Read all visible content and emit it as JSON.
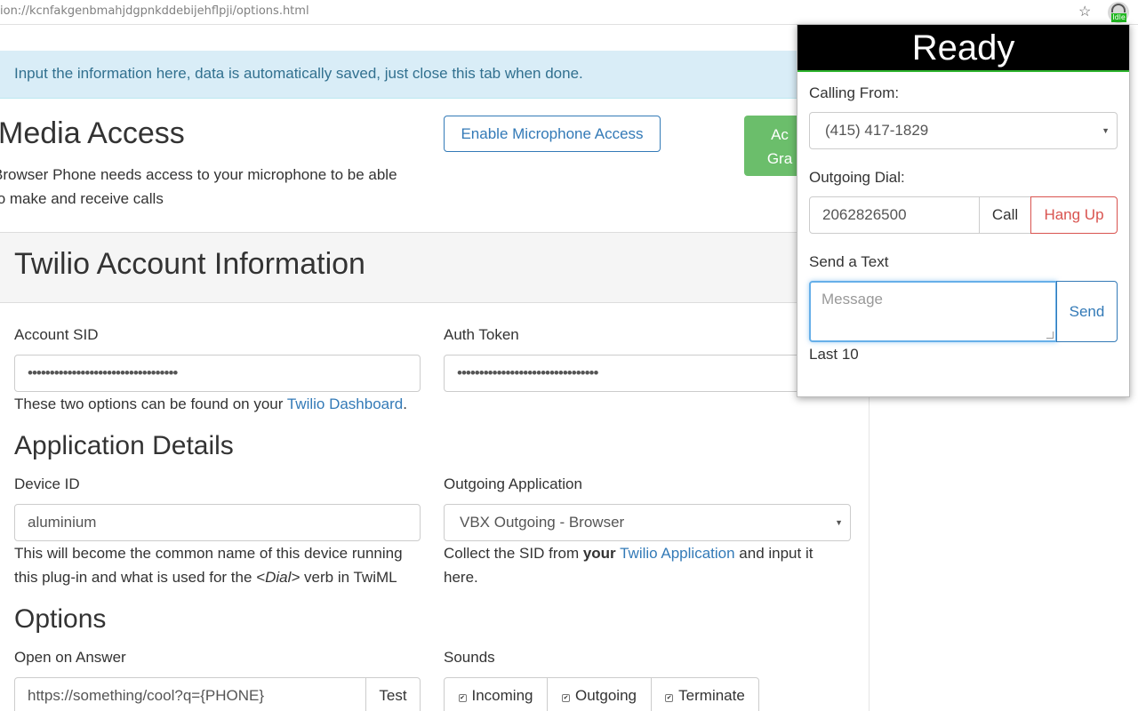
{
  "browser": {
    "url": "ion://kcnfakgenbmahjdgpnkddebijehflpji/options.html",
    "extension_badge": "Idle"
  },
  "alert": "Input the information here, data is automatically saved, just close this tab when done.",
  "media": {
    "title": "Media Access",
    "desc_line1": "Browser Phone needs access to your microphone to be able",
    "desc_line2": "to make and receive calls",
    "enable_button": "Enable Microphone Access",
    "green_button_line1": "Ac",
    "green_button_line2": "Gra"
  },
  "twilio": {
    "title": "Twilio Account Information",
    "sid_label": "Account SID",
    "sid_value": "••••••••••••••••••••••••••••••••••",
    "token_label": "Auth Token",
    "token_value": "••••••••••••••••••••••••••••••••",
    "help_prefix": "These two options can be found on your ",
    "help_link": "Twilio Dashboard",
    "help_suffix": "."
  },
  "app": {
    "title": "Application Details",
    "device_label": "Device ID",
    "device_value": "aluminium",
    "device_help_1": "This will become the common name of this device running",
    "device_help_2a": "this plug-in and what is used for the ",
    "device_help_2b": "<Dial>",
    "device_help_2c": " verb in TwiML",
    "outgoing_label": "Outgoing Application",
    "outgoing_value": "VBX Outgoing - Browser",
    "outgoing_help_a": "Collect the SID from ",
    "outgoing_help_b": "your",
    "outgoing_help_link": "Twilio Application",
    "outgoing_help_c": " and input it",
    "outgoing_help_2": "here."
  },
  "options": {
    "title": "Options",
    "open_label": "Open on Answer",
    "open_value": "https://something/cool?q={PHONE}",
    "test_button": "Test",
    "sounds_label": "Sounds",
    "sounds": [
      "Incoming",
      "Outgoing",
      "Terminate"
    ]
  },
  "popup": {
    "status": "Ready",
    "calling_from_label": "Calling From:",
    "calling_from_value": "(415) 417-1829",
    "outgoing_dial_label": "Outgoing Dial:",
    "dial_value": "2062826500",
    "call_button": "Call",
    "hangup_button": "Hang Up",
    "text_label": "Send a Text",
    "message_placeholder": "Message",
    "send_button": "Send",
    "last10_link": "Last 10"
  },
  "colors": {
    "primary": "#337ab7",
    "danger": "#d9534f",
    "success": "#5cb85c",
    "alert_bg": "#d9edf7"
  }
}
